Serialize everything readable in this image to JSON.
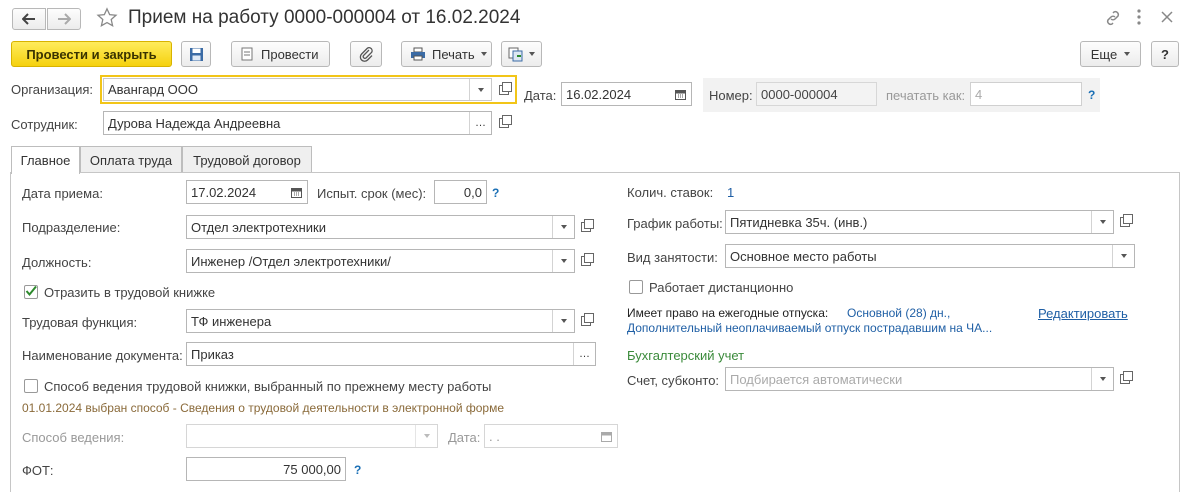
{
  "titlebar": {
    "title": "Прием на работу 0000-000004 от 16.02.2024"
  },
  "toolbar": {
    "post_close_label": "Провести и закрыть",
    "post_label": "Провести",
    "print_label": "Печать",
    "more_label": "Еще",
    "help_label": "?"
  },
  "header": {
    "organization_label": "Организация:",
    "organization_value": "Авангард ООО",
    "date_label": "Дата:",
    "date_value": "16.02.2024",
    "number_label": "Номер:",
    "number_value": "0000-000004",
    "print_as_label": "печатать как:",
    "print_as_placeholder": "4",
    "help_mark": "?",
    "employee_label": "Сотрудник:",
    "employee_value": "Дурова Надежда Андреевна"
  },
  "tabs": [
    {
      "label": "Главное"
    },
    {
      "label": "Оплата труда"
    },
    {
      "label": "Трудовой договор"
    }
  ],
  "main": {
    "hire_date_label": "Дата приема:",
    "hire_date_value": "17.02.2024",
    "probation_label": "Испыт. срок (мес):",
    "probation_value": "0,0",
    "help_mark": "?",
    "department_label": "Подразделение:",
    "department_value": "Отдел электротехники",
    "position_label": "Должность:",
    "position_value": "Инженер /Отдел электротехники/",
    "workbook_label": "Отразить в трудовой книжке",
    "labor_function_label": "Трудовая функция:",
    "labor_function_value": "ТФ инженера",
    "doc_name_label": "Наименование документа:",
    "doc_name_value": "Приказ",
    "prev_method_label": "Способ ведения трудовой книжки, выбранный по прежнему месту работы",
    "method_note": "01.01.2024 выбран способ - Сведения о трудовой деятельности в электронной форме",
    "method_label": "Способ ведения:",
    "method_date_label": "Дата:",
    "method_date_value": " .  .",
    "fot_label": "ФОТ:",
    "fot_value": "75 000,00",
    "rates_label": "Колич. ставок:",
    "rates_value": "1",
    "schedule_label": "График работы:",
    "schedule_value": "Пятидневка 35ч. (инв.)",
    "employment_label": "Вид занятости:",
    "employment_value": "Основное место работы",
    "remote_label": "Работает дистанционно",
    "vacation_label": "Имеет право на ежегодные отпуска:",
    "vacation_main": "Основной (28) дн.,",
    "vacation_extra": "Дополнительный неоплачиваемый отпуск пострадавшим на ЧА...",
    "edit_link": "Редактировать",
    "accounting_header": "Бухгалтерский учет",
    "account_label": "Счет, субконто:",
    "account_placeholder": "Подбирается автоматически"
  },
  "colors": {
    "accent_yellow": "#f5d10f",
    "link_blue": "#1f5fa5",
    "green_header": "#3a8a3a",
    "note_brown": "#8a6a3a"
  }
}
